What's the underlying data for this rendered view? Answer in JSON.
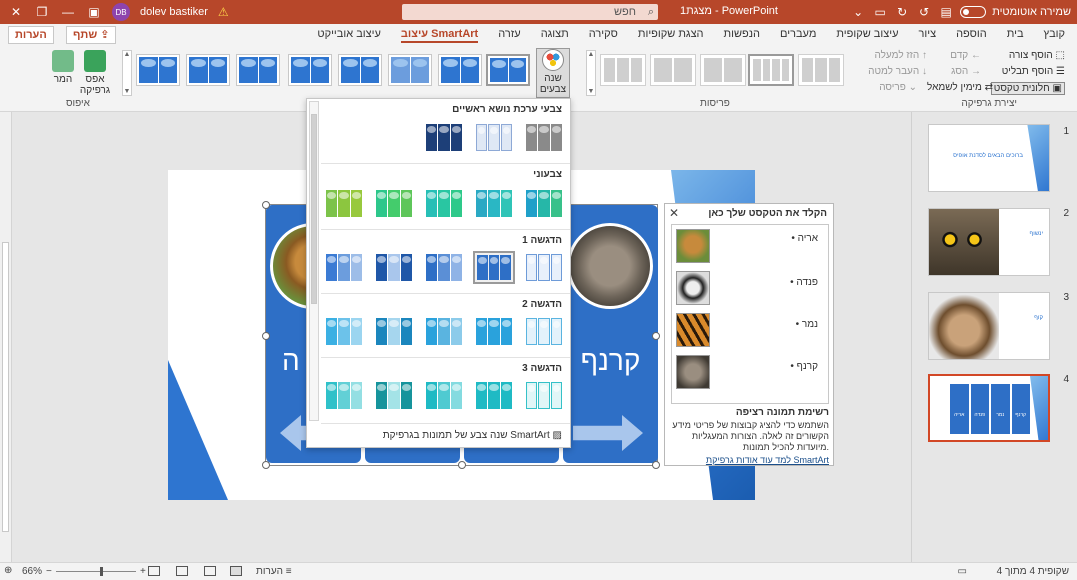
{
  "titlebar": {
    "autosave_label": "שמירה אוטומטית",
    "doc_title": "מצגת1 - PowerPoint",
    "search_placeholder": "חפש",
    "user_name": "dolev bastiker",
    "user_initials": "DB"
  },
  "menu": {
    "tabs": [
      "קובץ",
      "בית",
      "הוספה",
      "ציור",
      "עיצוב שקופית",
      "מעברים",
      "הנפשות",
      "הצגת שקופיות",
      "סקירה",
      "תצוגה",
      "עזרה",
      "עיצוב SmartArt",
      "עיצוב אובייקט"
    ],
    "active_tab": "עיצוב SmartArt",
    "share_label": "שתף",
    "comments_label": "הערות"
  },
  "ribbon": {
    "create_graphic": {
      "label": "יצירת גרפיקה",
      "add_shape": "הוסף צורה",
      "add_bullet": "הוסף תבליט",
      "text_pane": "חלונית טקסט",
      "promote": "קדם",
      "demote": "הסג",
      "right_to_left": "מימין לשמאל",
      "move_up": "הזז למעלה",
      "move_down": "העבר למטה",
      "layout": "פריסה"
    },
    "layouts_label": "פריסות",
    "change_colors": "שנה צבעים",
    "reset": {
      "label": "איפוס",
      "reset_graphic": "אפס גרפיקה",
      "convert": "המר"
    }
  },
  "color_dropdown": {
    "sections": [
      {
        "title": "צבעי ערכת נושא ראשיים"
      },
      {
        "title": "צבעוני"
      },
      {
        "title": "הדגשה 1"
      },
      {
        "title": "הדגשה 2"
      },
      {
        "title": "הדגשה 3"
      }
    ],
    "footer": "שנה צבע של תמונות בגרפיקת SmartArt"
  },
  "smartart": {
    "items": [
      "קרנף",
      "נמר",
      "פנדה",
      "אריה"
    ],
    "visible_labels": [
      "קרנף",
      "ה"
    ]
  },
  "text_pane": {
    "title": "הקלד את הטקסט שלך כאן",
    "bullets": [
      "אריה",
      "פנדה",
      "נמר",
      "קרנף"
    ],
    "desc_title": "רשימת תמונה רציפה",
    "desc_text": "השתמש כדי להציג קבוצות של פריטי מידע הקשורים זה לאלה. הצורות המעגליות מיועדות להכיל תמונות.",
    "learn_more": "למד עוד אודות גרפיקת SmartArt"
  },
  "thumbnails": {
    "slides": [
      {
        "num": "1",
        "title": "ברוכים הבאים לסדנת אופיס"
      },
      {
        "num": "2",
        "title": "ינשוף"
      },
      {
        "num": "3",
        "title": "קוף"
      },
      {
        "num": "4",
        "title": ""
      }
    ],
    "slide4_labels": [
      "קרנף",
      "נמר",
      "פנדה",
      "אריה"
    ]
  },
  "statusbar": {
    "slide_of": "שקופית 4 מתוך 4",
    "notes": "הערות",
    "zoom": "66%"
  },
  "colors": {
    "accent": "#b7472a",
    "smartart_blue": "#2e6fc6"
  }
}
